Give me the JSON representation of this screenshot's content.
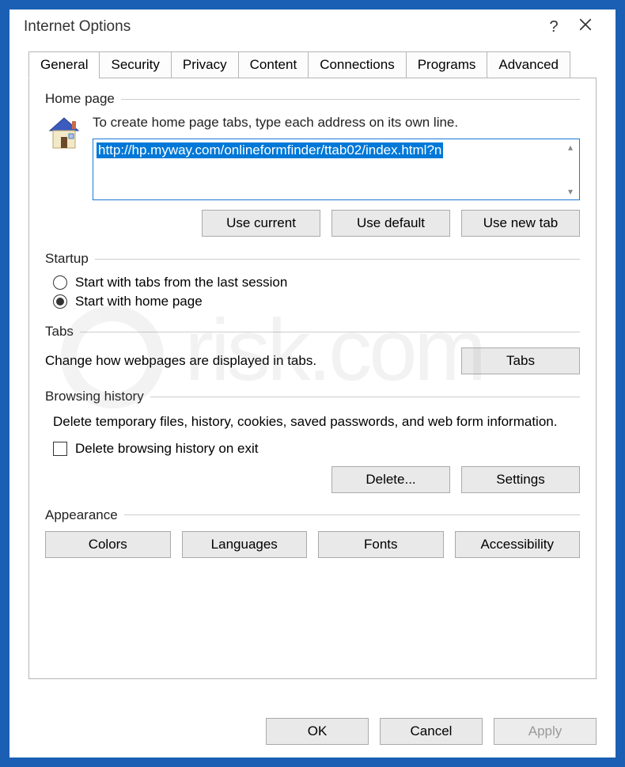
{
  "window": {
    "title": "Internet Options"
  },
  "tabs": [
    "General",
    "Security",
    "Privacy",
    "Content",
    "Connections",
    "Programs",
    "Advanced"
  ],
  "active_tab_index": 0,
  "homepage": {
    "group_label": "Home page",
    "instruction": "To create home page tabs, type each address on its own line.",
    "url": "http://hp.myway.com/onlineformfinder/ttab02/index.html?n",
    "buttons": {
      "use_current": "Use current",
      "use_default": "Use default",
      "use_new_tab": "Use new tab"
    }
  },
  "startup": {
    "group_label": "Startup",
    "option_last_session": "Start with tabs from the last session",
    "option_home_page": "Start with home page",
    "selected": "home_page"
  },
  "tabs_section": {
    "group_label": "Tabs",
    "description": "Change how webpages are displayed in tabs.",
    "button": "Tabs"
  },
  "history": {
    "group_label": "Browsing history",
    "description": "Delete temporary files, history, cookies, saved passwords, and web form information.",
    "checkbox_label": "Delete browsing history on exit",
    "checkbox_checked": false,
    "delete_btn": "Delete...",
    "settings_btn": "Settings"
  },
  "appearance": {
    "group_label": "Appearance",
    "colors": "Colors",
    "languages": "Languages",
    "fonts": "Fonts",
    "accessibility": "Accessibility"
  },
  "footer": {
    "ok": "OK",
    "cancel": "Cancel",
    "apply": "Apply"
  }
}
